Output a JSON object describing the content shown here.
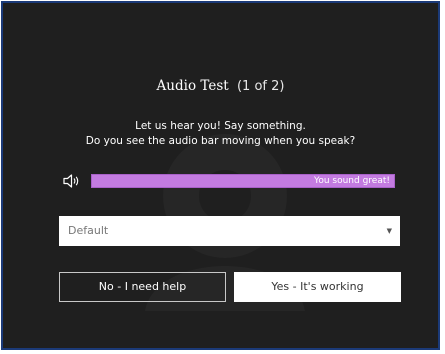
{
  "dialog": {
    "title": "Audio Test",
    "step": "(1 of 2)",
    "prompt_line1": "Let us hear you! Say something.",
    "prompt_line2": "Do you see the audio bar moving when you speak?"
  },
  "audio_meter": {
    "status_text": "You sound great!",
    "level_percent": 100,
    "bar_color": "#c37be0"
  },
  "device_select": {
    "selected": "Default"
  },
  "actions": {
    "no_label": "No - I need help",
    "yes_label": "Yes - It's working"
  },
  "icons": {
    "speaker": "speaker-icon",
    "caret": "caret-down-icon"
  },
  "colors": {
    "background": "#1f1f1f",
    "frame_border": "#1b3a78"
  }
}
